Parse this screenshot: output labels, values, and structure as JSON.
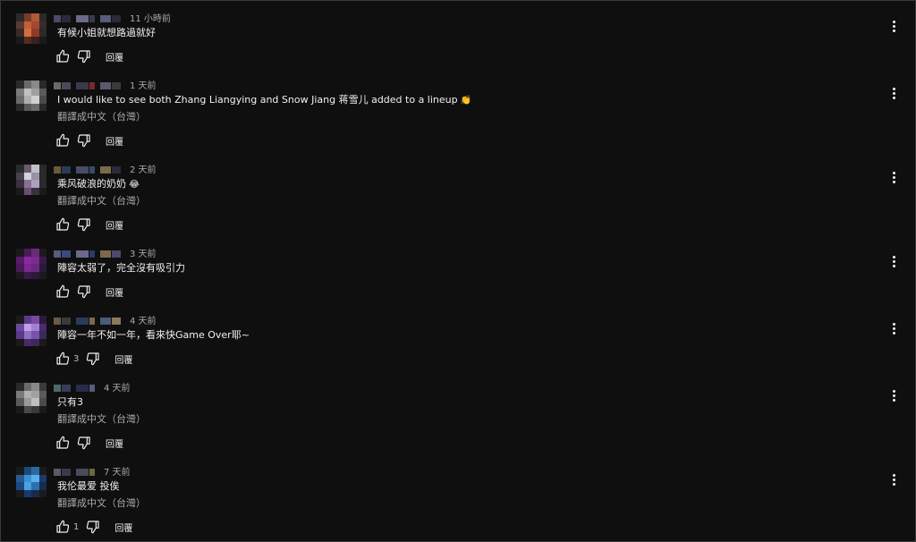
{
  "translate_label": "翻譯成中文（台灣）",
  "reply_label": "回覆",
  "comments": [
    {
      "time": "11 小時前",
      "text": "有候小姐就想路過就好",
      "translate": "",
      "likes": "",
      "avatar": [
        "#2a2a2a",
        "#7a3a2a",
        "#b05a3a",
        "#2a2a2a",
        "#5a3a30",
        "#c0603a",
        "#a04a30",
        "#3a2a2a",
        "#3a2a2a",
        "#d07040",
        "#903a28",
        "#2a2a2a",
        "#1a1a1a",
        "#5a2a20",
        "#3a2020",
        "#1a1a1a"
      ],
      "blur": [
        "#4a4a6a",
        "#2a2a3a",
        "#6a6a8a",
        "#3a3a4a",
        "#5a5a7a",
        "#2a2a3a"
      ]
    },
    {
      "time": "1 天前",
      "text": "I would like to see both Zhang Liangying and Snow Jiang 蒋雪儿 added to a lineup",
      "emoji": "👏",
      "translate": "翻譯成中文（台灣）",
      "likes": "",
      "avatar": [
        "#2a2a2a",
        "#6a6a6a",
        "#8a8a8a",
        "#2a2a2a",
        "#7a7a7a",
        "#c0c0c0",
        "#a0a0a0",
        "#5a5a5a",
        "#6a6a6a",
        "#b0b0b0",
        "#d0d0d0",
        "#4a4a4a",
        "#2a2a2a",
        "#5a5a5a",
        "#6a6a6a",
        "#2a2a2a"
      ],
      "blur": [
        "#6a6a6a",
        "#4a4a5a",
        "#3a3a4a",
        "#7a2a2a",
        "#5a5a6a",
        "#3a3a3a"
      ]
    },
    {
      "time": "2 天前",
      "text": "乘风破浪的奶奶",
      "emoji": "😂",
      "translate": "翻譯成中文（台灣）",
      "likes": "",
      "avatar": [
        "#2a2a2a",
        "#6a5a6a",
        "#c0c0c8",
        "#2a2a2a",
        "#4a4050",
        "#d0d0e0",
        "#9a90a8",
        "#2a2a2a",
        "#3a3040",
        "#8a7090",
        "#b0a0c0",
        "#2a2a2a",
        "#1a1a1a",
        "#6a5070",
        "#3a3040",
        "#1a1a1a"
      ],
      "blur": [
        "#6a5a3a",
        "#2a3a5a",
        "#4a4a6a",
        "#3a4a6a",
        "#7a6a4a",
        "#2a2a3a"
      ]
    },
    {
      "time": "3 天前",
      "text": "陣容太弱了，完全沒有吸引力",
      "translate": "",
      "likes": "",
      "avatar": [
        "#1a1a1a",
        "#4a1a5a",
        "#6a2a7a",
        "#1a1a1a",
        "#5a1a6a",
        "#8a2aa0",
        "#7a2a90",
        "#3a1a4a",
        "#4a1a5a",
        "#7a2a90",
        "#6a2a80",
        "#2a1a3a",
        "#1a1a1a",
        "#3a1a4a",
        "#2a1a3a",
        "#1a1a1a"
      ],
      "blur": [
        "#5a5a7a",
        "#3a4a7a",
        "#6a6a8a",
        "#2a3a6a",
        "#7a6a4a",
        "#4a4a6a"
      ]
    },
    {
      "time": "4 天前",
      "text": "陣容一年不如一年，看來快Game Over耶~",
      "translate": "",
      "likes": "3",
      "avatar": [
        "#1a1a1a",
        "#5a3a8a",
        "#7a4aa0",
        "#2a1a3a",
        "#6a4a9a",
        "#c0a0e8",
        "#a080d0",
        "#4a2a6a",
        "#5a3a8a",
        "#9070c0",
        "#7a50b0",
        "#3a2a5a",
        "#1a1a1a",
        "#4a2a6a",
        "#3a2a5a",
        "#1a1a1a"
      ],
      "blur": [
        "#6a5a4a",
        "#3a3a3a",
        "#2a3a5a",
        "#7a6a4a",
        "#4a5a7a",
        "#8a7a5a"
      ]
    },
    {
      "time": "4 天前",
      "text": "只有3",
      "translate": "翻譯成中文（台灣）",
      "likes": "",
      "avatar": [
        "#2a2a2a",
        "#6a6a6a",
        "#8a8a8a",
        "#3a3a3a",
        "#7a7a7a",
        "#b0b0b0",
        "#a0a0a0",
        "#5a5a5a",
        "#5a5a5a",
        "#9a9a9a",
        "#c0c0c0",
        "#4a4a4a",
        "#1a1a1a",
        "#4a4a4a",
        "#3a3a3a",
        "#1a1a1a"
      ],
      "blur": [
        "#4a6a6a",
        "#3a3a5a",
        "#2a2a4a",
        "#5a5a7a"
      ]
    },
    {
      "time": "7 天前",
      "text": "我伦最爱 投俟",
      "translate": "翻譯成中文（台灣）",
      "likes": "1",
      "avatar": [
        "#1a1a1a",
        "#1a4a7a",
        "#2a6aa0",
        "#1a1a1a",
        "#2a5a90",
        "#3a90d0",
        "#5ab0e8",
        "#1a3a6a",
        "#1a4a80",
        "#4aa0e0",
        "#2a70b0",
        "#1a2a4a",
        "#1a1a1a",
        "#1a3a6a",
        "#1a2a4a",
        "#1a1a1a"
      ],
      "blur": [
        "#5a5a6a",
        "#3a3a4a",
        "#4a4a5a",
        "#6a6a3a"
      ]
    }
  ]
}
